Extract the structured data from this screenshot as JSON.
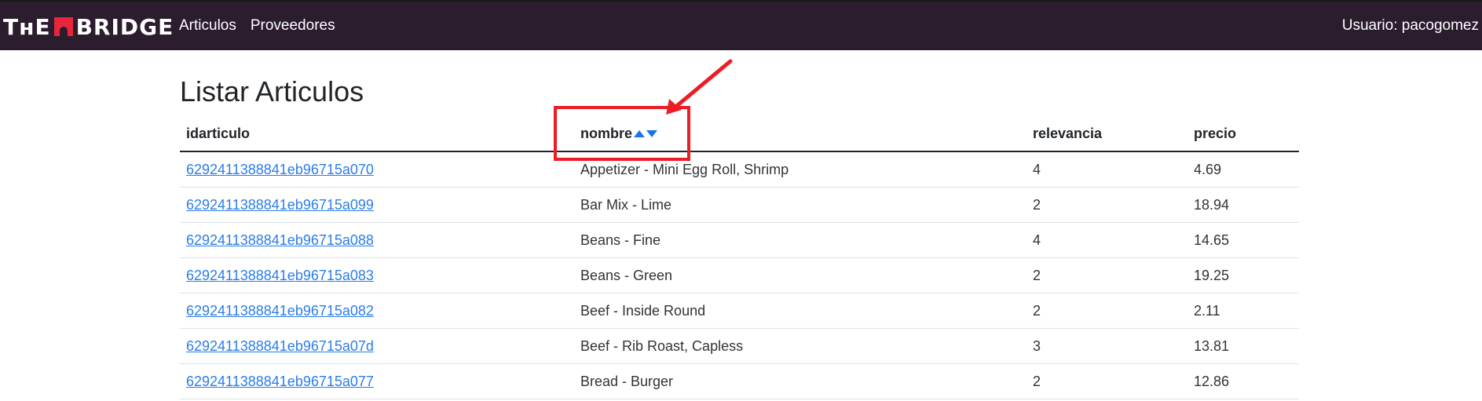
{
  "navbar": {
    "brand_the": "TʜE",
    "brand_bridge": "BRIDGE",
    "links": [
      {
        "label": "Articulos"
      },
      {
        "label": "Proveedores"
      }
    ],
    "user": "Usuario: pacogomez"
  },
  "page": {
    "title": "Listar Articulos"
  },
  "table": {
    "headers": {
      "id": "idarticulo",
      "name": "nombre",
      "relevance": "relevancia",
      "price": "precio"
    },
    "rows": [
      {
        "id": "6292411388841eb96715a070",
        "name": "Appetizer - Mini Egg Roll, Shrimp",
        "relevance": "4",
        "price": "4.69"
      },
      {
        "id": "6292411388841eb96715a099",
        "name": "Bar Mix - Lime",
        "relevance": "2",
        "price": "18.94"
      },
      {
        "id": "6292411388841eb96715a088",
        "name": "Beans - Fine",
        "relevance": "4",
        "price": "14.65"
      },
      {
        "id": "6292411388841eb96715a083",
        "name": "Beans - Green",
        "relevance": "2",
        "price": "19.25"
      },
      {
        "id": "6292411388841eb96715a082",
        "name": "Beef - Inside Round",
        "relevance": "2",
        "price": "2.11"
      },
      {
        "id": "6292411388841eb96715a07d",
        "name": "Beef - Rib Roast, Capless",
        "relevance": "3",
        "price": "13.81"
      },
      {
        "id": "6292411388841eb96715a077",
        "name": "Bread - Burger",
        "relevance": "2",
        "price": "12.86"
      }
    ]
  },
  "colors": {
    "navbar_bg": "#2b1d2e",
    "brand_accent": "#e8253b",
    "link": "#2b7de9",
    "sort_arrow": "#1a73e8",
    "annotation": "#ee1c24"
  },
  "icons": {
    "sort_up": "sort-ascending-icon",
    "sort_down": "sort-descending-icon",
    "annotation_arrow": "annotation-arrow-icon"
  }
}
